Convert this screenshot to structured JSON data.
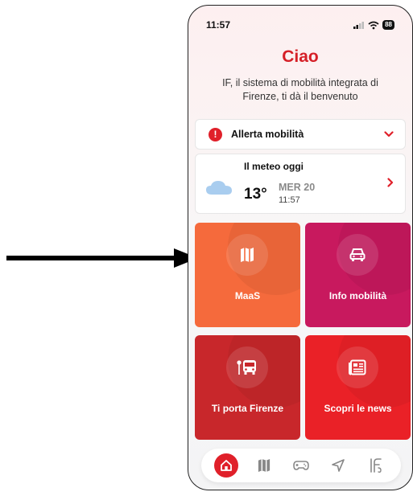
{
  "status_bar": {
    "time": "11:57",
    "battery": "88"
  },
  "header": {
    "greeting": "Ciao",
    "subtitle": "IF, il sistema di mobilità integrata di Firenze, ti dà il benvenuto"
  },
  "alert": {
    "label": "Allerta mobilità",
    "badge": "!"
  },
  "weather": {
    "title": "Il meteo oggi",
    "temperature": "13°",
    "day": "MER 20",
    "time": "11:57",
    "condition_icon": "cloud-icon"
  },
  "tiles": [
    {
      "label": "MaaS",
      "icon": "map-icon",
      "color": "#f56a3c"
    },
    {
      "label": "Info mobilità",
      "icon": "car-icon",
      "color": "#c8195e"
    },
    {
      "label": "Ti porta Firenze",
      "icon": "bus-stop-icon",
      "color": "#c8272b"
    },
    {
      "label": "Scopri le news",
      "icon": "newspaper-icon",
      "color": "#ea2127"
    }
  ],
  "tab_bar": {
    "items": [
      "home-icon",
      "map-icon",
      "gamepad-icon",
      "navigation-icon",
      "if-logo-icon"
    ],
    "active": "home-icon"
  },
  "colors": {
    "accent": "#e0202a"
  }
}
